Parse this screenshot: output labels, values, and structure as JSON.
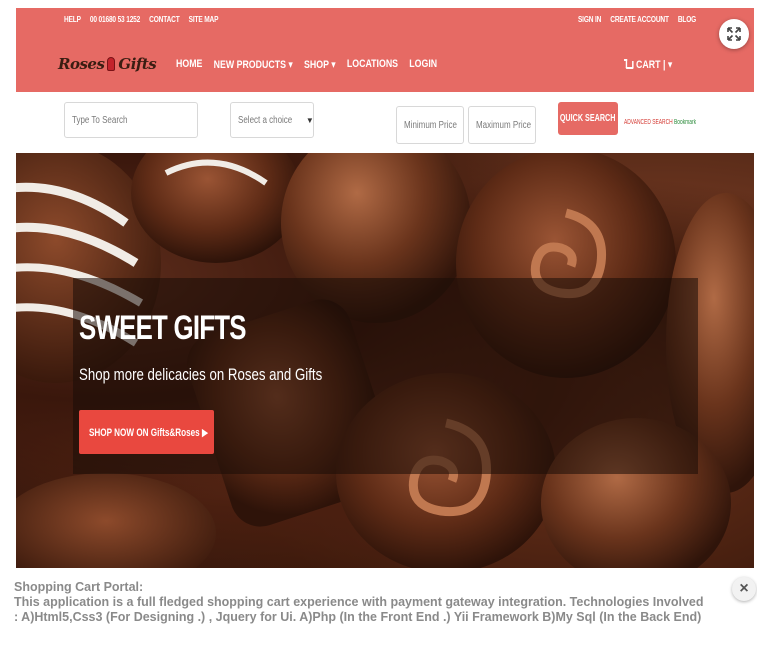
{
  "header": {
    "util_left": [
      "HELP",
      "00 01680 53 1252",
      "CONTACT",
      "SITE MAP"
    ],
    "util_right": [
      "SIGN IN",
      "CREATE ACCOUNT",
      "BLOG"
    ],
    "logo_left": "Roses",
    "logo_right": "Gifts",
    "nav": [
      "HOME",
      "NEW PRODUCTS ▾",
      "SHOP ▾",
      "LOCATIONS",
      "LOGIN"
    ],
    "cart_label": "CART | ▾",
    "brand_color": "#e66a64"
  },
  "search": {
    "search_placeholder": "Type To Search",
    "select_value": "Select a choice",
    "min_price_placeholder": "Minimum Price",
    "max_price_placeholder": "Maximum Price",
    "quick_search_label": "QUICK SEARCH",
    "advanced_search_label": "ADVANCED SEARCH",
    "bookmark_label": "Bookmark"
  },
  "hero": {
    "title": "SWEET GIFTS",
    "subtitle": "Shop more delicacies on Roses and Gifts",
    "cta_label": "SHOP NOW ON Gifts&Roses ▶",
    "cta_color": "#e9483f"
  },
  "modal": {
    "caption_title": "Shopping Cart Portal:",
    "caption_body": "This application is a full fledged shopping cart experience with payment gateway integration. Technologies Involved : A)Html5,Css3 (For Designing .) , Jquery for Ui. A)Php (In the Front End .) Yii Framework B)My Sql (In the Back End)",
    "close_symbol": "×"
  }
}
